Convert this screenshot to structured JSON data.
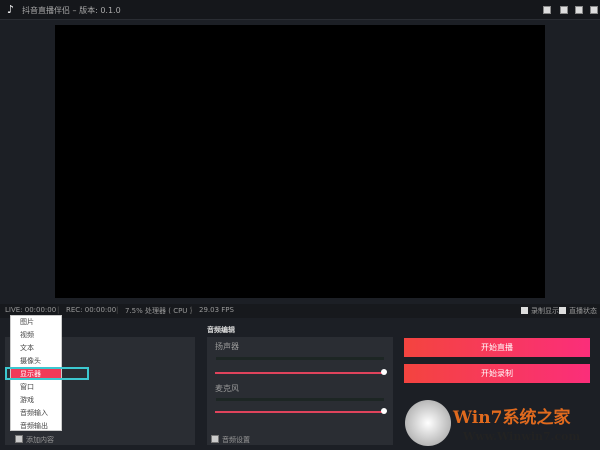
{
  "window": {
    "title": "抖音直播伴侣 – 版本: 0.1.0"
  },
  "status": {
    "live": "LIVE: 00:00:00",
    "rec": "REC: 00:00:00",
    "cpu": "7.5% 处理器 ( CPU )",
    "fps": "29.03 FPS",
    "sep": "|",
    "record_display": "录制显示",
    "live_status": "直播状态"
  },
  "sources": {
    "add_label": "添加内容",
    "menu": [
      "图片",
      "视频",
      "文本",
      "摄像头",
      "显示器",
      "窗口",
      "游戏",
      "音频输入",
      "音频输出"
    ],
    "selected": "显示器"
  },
  "audio": {
    "title": "音频编辑",
    "speaker": "扬声器",
    "mic": "麦克风",
    "settings": "音频设置",
    "speaker_volume": 1.0,
    "mic_volume": 1.0
  },
  "actions": {
    "start_live": "开始直播",
    "start_record": "开始录制"
  },
  "watermark": {
    "brand": "Win7系统之家",
    "url": "Www.Winwin7.com"
  },
  "colors": {
    "accent": "#f03a58",
    "highlight": "#3cc8d0"
  }
}
